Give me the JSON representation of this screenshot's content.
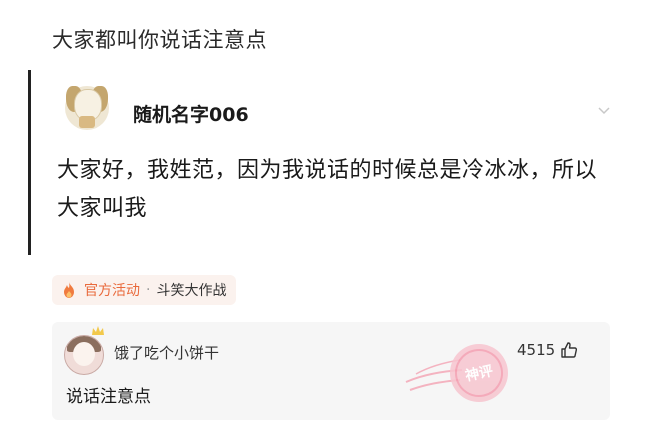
{
  "thread": {
    "title": "大家都叫你说话注意点"
  },
  "quoted_post": {
    "username": "随机名字006",
    "body": "大家好，我姓范，因为我说话的时候总是冷冰冰，所以大家叫我",
    "icons": {
      "avatar": "dog-avatar",
      "menu": "chevron-down-icon"
    }
  },
  "activity": {
    "official": "官方活动",
    "separator": "·",
    "event": "斗笑大作战",
    "icon": "flame-icon",
    "color": "#e96a3c"
  },
  "comment": {
    "username": "饿了吃个小饼干",
    "likes": "4515",
    "text": "说话注意点",
    "stamp": "神评",
    "icons": {
      "like": "thumbs-up-icon",
      "badge": "crown-icon"
    }
  }
}
